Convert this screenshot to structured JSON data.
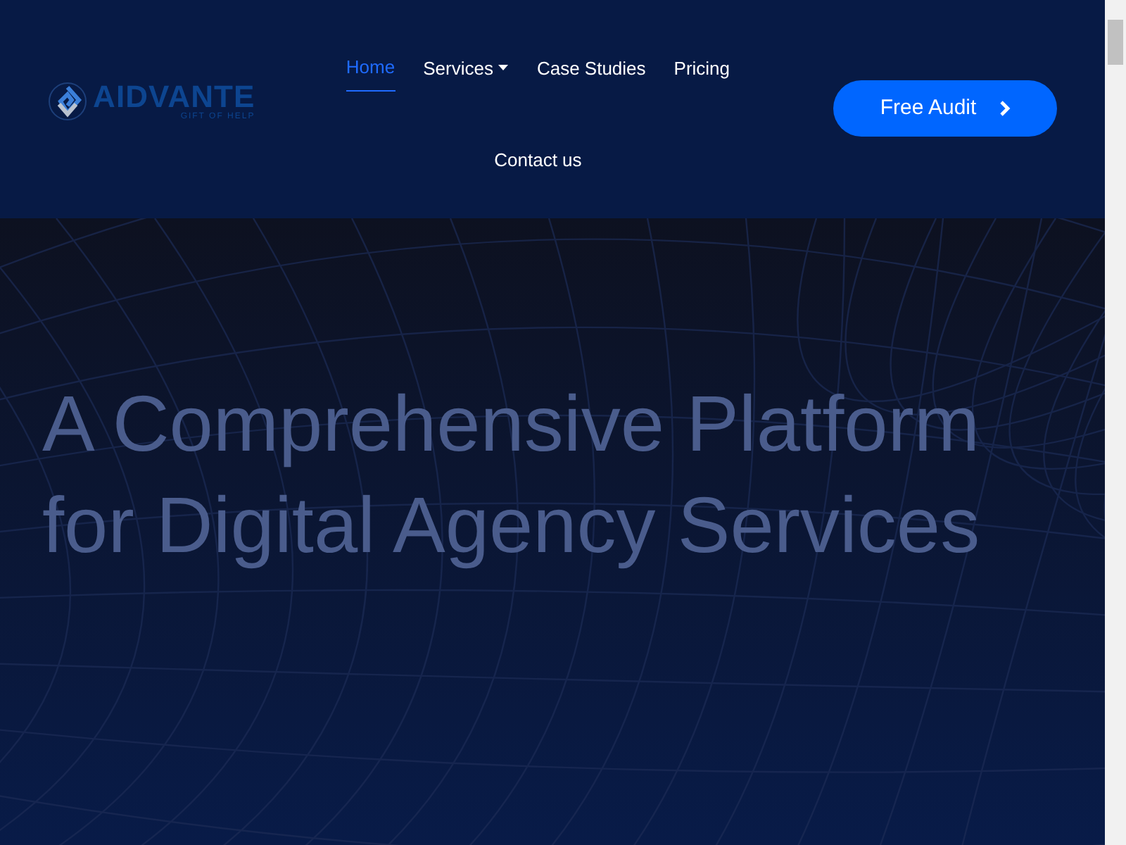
{
  "logo": {
    "name": "AIDVANTE",
    "tagline": "GIFT OF HELP"
  },
  "nav": [
    {
      "label": "Home",
      "selected": true,
      "dropdown": false
    },
    {
      "label": "Services",
      "selected": false,
      "dropdown": true
    },
    {
      "label": "Case Studies",
      "selected": false,
      "dropdown": false
    },
    {
      "label": "Pricing",
      "selected": false,
      "dropdown": false
    },
    {
      "label": "Contact us",
      "selected": false,
      "dropdown": false
    }
  ],
  "cta": {
    "label": "Free Audit"
  },
  "hero": {
    "lines": [
      "A Comprehensive Platform",
      "for Digital Agency Services"
    ]
  }
}
